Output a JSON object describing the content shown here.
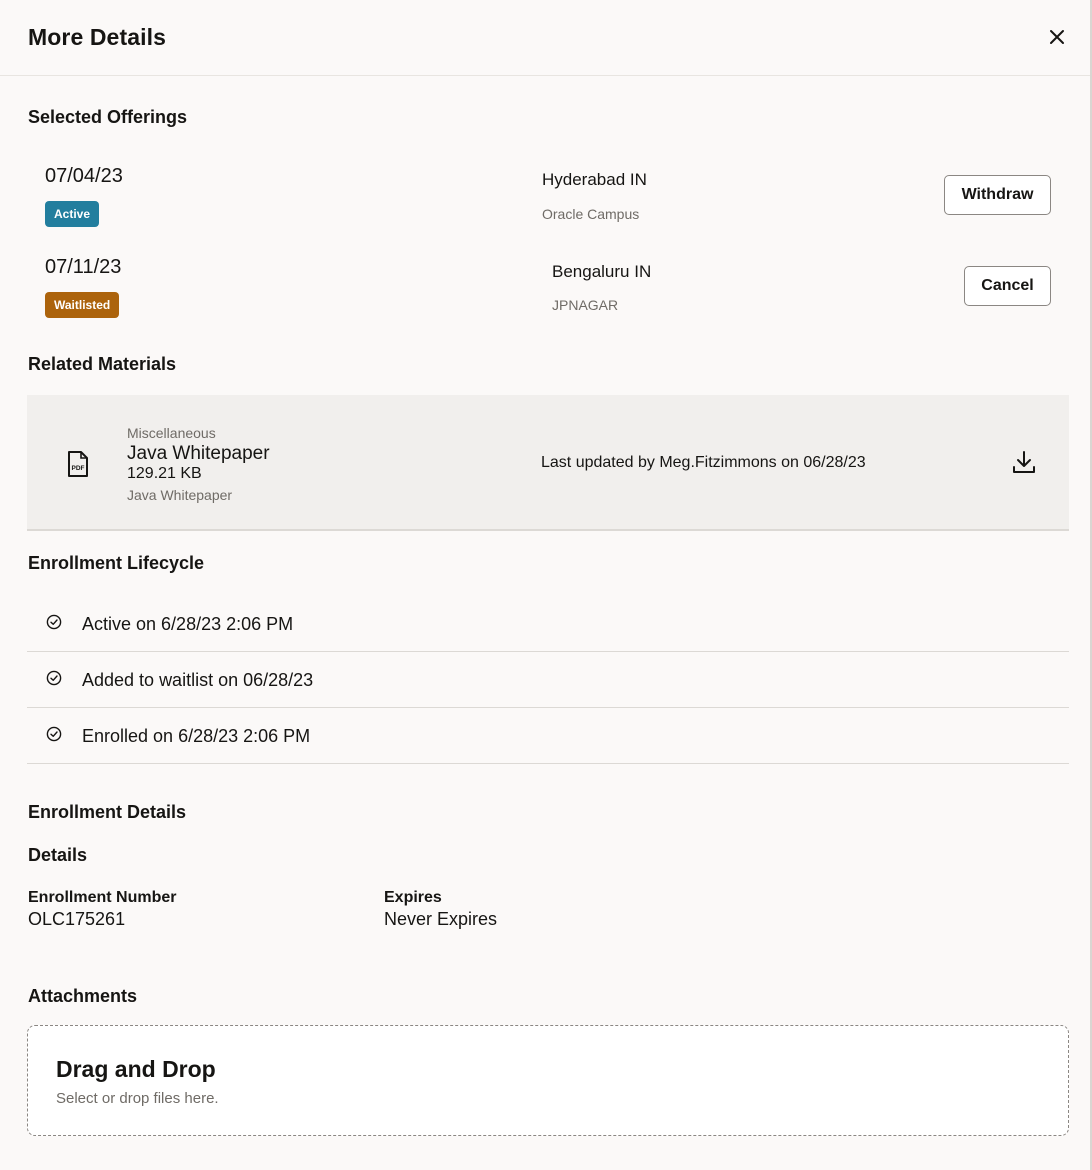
{
  "header": {
    "title": "More Details"
  },
  "offerings": {
    "heading": "Selected Offerings",
    "items": [
      {
        "date": "07/04/23",
        "status": "Active",
        "location": "Hyderabad IN",
        "venue": "Oracle Campus",
        "action": "Withdraw"
      },
      {
        "date": "07/11/23",
        "status": "Waitlisted",
        "location": "Bengaluru IN",
        "venue": "JPNAGAR",
        "action": "Cancel"
      }
    ]
  },
  "materials": {
    "heading": "Related Materials",
    "item": {
      "category": "Miscellaneous",
      "name": "Java Whitepaper",
      "size": "129.21 KB",
      "description": "Java Whitepaper",
      "updated": "Last updated by Meg.Fitzimmons on 06/28/23",
      "file_icon_text": "PDF"
    }
  },
  "lifecycle": {
    "heading": "Enrollment Lifecycle",
    "events": [
      "Active on 6/28/23 2:06 PM",
      "Added to waitlist on 06/28/23",
      "Enrolled on 6/28/23 2:06 PM"
    ]
  },
  "enrollment": {
    "heading": "Enrollment Details",
    "subheading": "Details",
    "number_label": "Enrollment Number",
    "number_value": "OLC175261",
    "expires_label": "Expires",
    "expires_value": "Never Expires"
  },
  "attachments": {
    "heading": "Attachments",
    "dropzone_title": "Drag and Drop",
    "dropzone_hint": "Select or drop files here."
  },
  "colors": {
    "active_badge": "#227e9e",
    "waitlisted_badge": "#ac630c",
    "background": "#fbf9f8"
  },
  "icons": {
    "close": "close-icon",
    "file": "pdf-file-icon",
    "download": "download-icon",
    "check": "check-circle-icon"
  }
}
